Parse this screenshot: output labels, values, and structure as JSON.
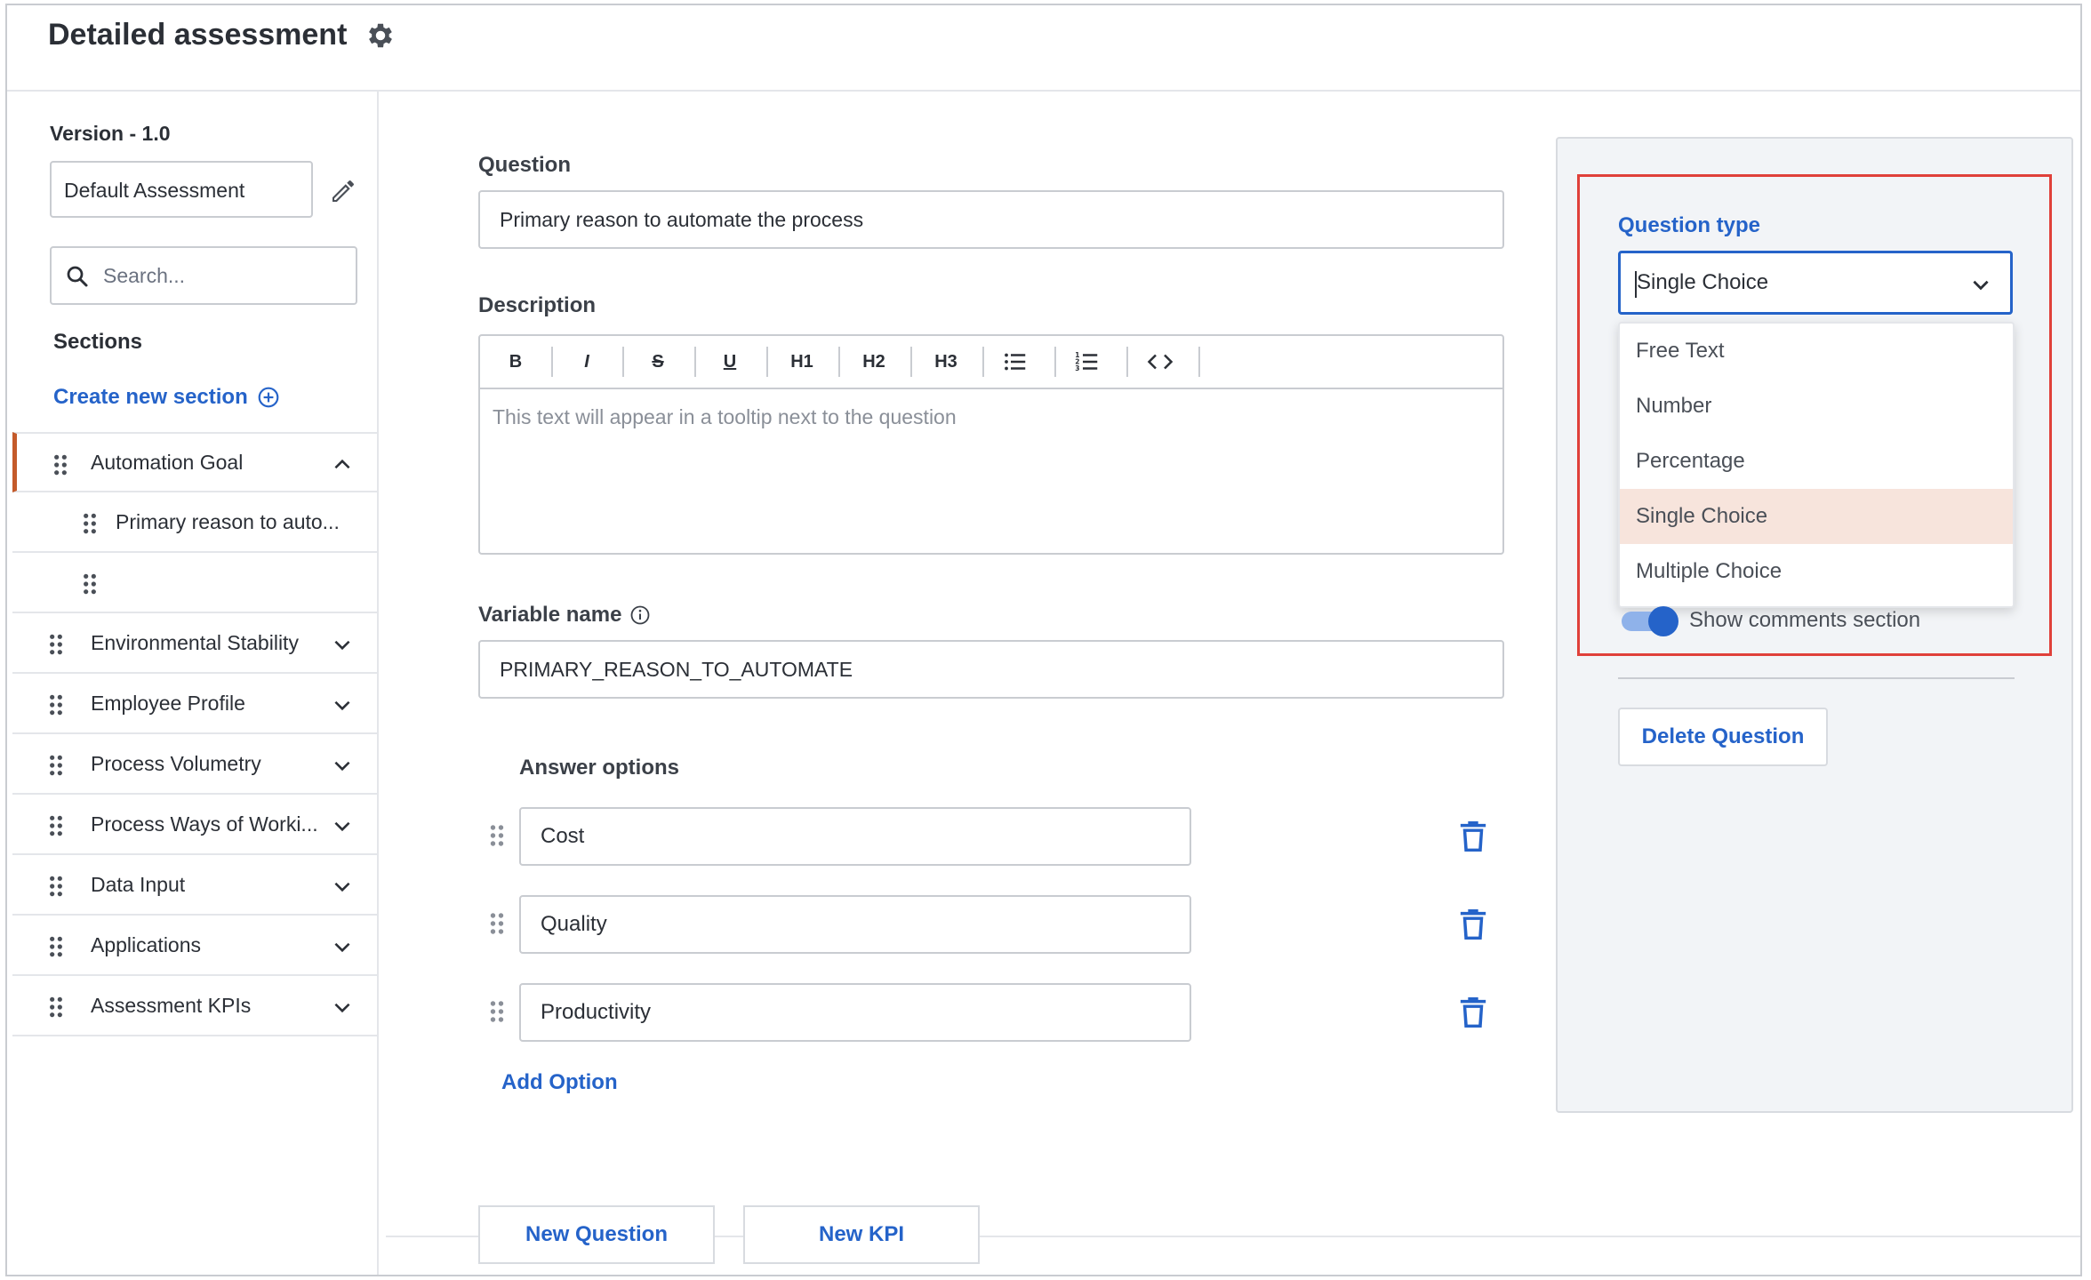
{
  "header": {
    "title": "Detailed assessment",
    "settings_icon": "gear-icon"
  },
  "sidebar": {
    "version": "Version - 1.0",
    "assessment_name": "Default Assessment",
    "search_placeholder": "Search...",
    "sections_label": "Sections",
    "create_section": "Create new section",
    "active_accent": "#c45a2a",
    "items": [
      {
        "label": "Automation Goal",
        "expanded": true,
        "children": [
          "Primary reason to auto...",
          ""
        ]
      },
      {
        "label": "Environmental Stability",
        "expanded": false
      },
      {
        "label": "Employee Profile",
        "expanded": false
      },
      {
        "label": "Process Volumetry",
        "expanded": false
      },
      {
        "label": "Process Ways of Worki...",
        "expanded": false
      },
      {
        "label": "Data Input",
        "expanded": false
      },
      {
        "label": "Applications",
        "expanded": false
      },
      {
        "label": "Assessment KPIs",
        "expanded": false
      }
    ]
  },
  "main": {
    "question_label": "Question",
    "question_value": "Primary reason to automate the process",
    "description_label": "Description",
    "toolbar": [
      "B",
      "I",
      "S",
      "U",
      "H1",
      "H2",
      "H3",
      "bulleted-list",
      "numbered-list",
      "code"
    ],
    "description_placeholder": "This text will appear in a tooltip next to the question",
    "variable_label": "Variable name",
    "variable_value": "PRIMARY_REASON_TO_AUTOMATE",
    "answers_label": "Answer options",
    "options": [
      "Cost",
      "Quality",
      "Productivity"
    ],
    "add_option": "Add Option",
    "new_question": "New Question",
    "new_kpi": "New KPI"
  },
  "panel": {
    "question_type_label": "Question type",
    "selected": "Single Choice",
    "dropdown_options": [
      "Free Text",
      "Number",
      "Percentage",
      "Single Choice",
      "Multiple Choice"
    ],
    "selected_index": 3,
    "show_comments_label": "Show comments section",
    "show_comments_on": true,
    "delete_label": "Delete Question",
    "accent": "#2563c9",
    "highlight": "#e0403a"
  }
}
